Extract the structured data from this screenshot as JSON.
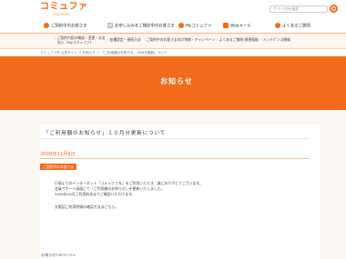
{
  "header": {
    "logo_main": "コミュファ",
    "logo_sub": "commufa",
    "search_placeholder": "サイト内を検索"
  },
  "mainnav": [
    {
      "label": "ご契約中のお客さま",
      "icon": "person-icon"
    },
    {
      "label": "お申し込みをご検討中のお客さま",
      "icon": "house-icon"
    },
    {
      "label": "Myコミュファ",
      "icon": "my-icon"
    },
    {
      "label": "Webメール",
      "icon": "mail-icon"
    },
    {
      "label": "よくあるご質問",
      "icon": "question-icon"
    }
  ],
  "subnav": {
    "col1_line1": "ご契約内容の確認・変更・お支",
    "col1_line2": "払い（Myコミュファ）",
    "items": [
      "各種設定・接続方法",
      "ご契約中のお客さま向け特典・キャンペーン",
      "よくあるご質問",
      "障害情報",
      "メンテナンス情報"
    ]
  },
  "breadcrumb": "コミュファ光 公式サイト ＞ お知らせ ＞ 「ご利用額のお知らせ」10月分更新について",
  "banner": {
    "title": "お知らせ"
  },
  "article": {
    "title": "「ご利用額のお知らせ」１０月分更新について",
    "date": "2009年11月9日",
    "tag": "ご契約中のお客さま",
    "lines": [
      "日頃より光インターネット「コミュファ光」をご利用いただき、誠にありがとうございます。",
      "会員サポート画面にて「ご利用額のお知らせ」を更新いたしました。",
      "2009年10月ご利用料金までご確認いただけます。",
      "",
      "光電話ご利用明細の確認方法はこちら。"
    ]
  },
  "footer_link": "お知らせTOPページへ"
}
